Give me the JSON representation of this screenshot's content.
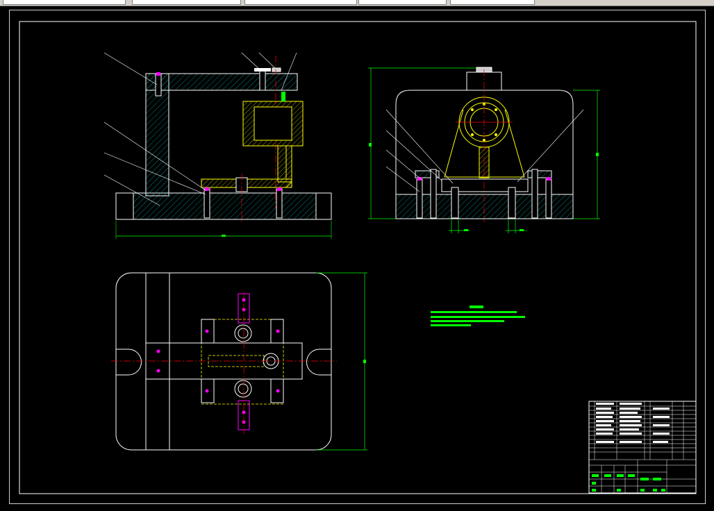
{
  "window": {
    "strip_fields": [
      "",
      "",
      "",
      "",
      ""
    ]
  },
  "colors": {
    "background": "#000000",
    "outline": "#ffffff",
    "centerline": "#ff0000",
    "hatch": "#00a0a0",
    "workpiece": "#ffff00",
    "dimension": "#00ff00",
    "bolt": "#ff00ff"
  },
  "drawing": {
    "views": [
      "front-view",
      "side-view",
      "top-view"
    ],
    "balloons": [
      "",
      "",
      "",
      "",
      "",
      "",
      "",
      "",
      "",
      "",
      "",
      ""
    ],
    "dimensions": [
      "",
      "",
      "",
      "",
      "",
      ""
    ]
  },
  "notes": {
    "title": "",
    "lines": [
      "",
      "",
      "",
      ""
    ]
  },
  "title_block": {
    "header": [
      "",
      "",
      "",
      ""
    ],
    "rows": 14
  }
}
